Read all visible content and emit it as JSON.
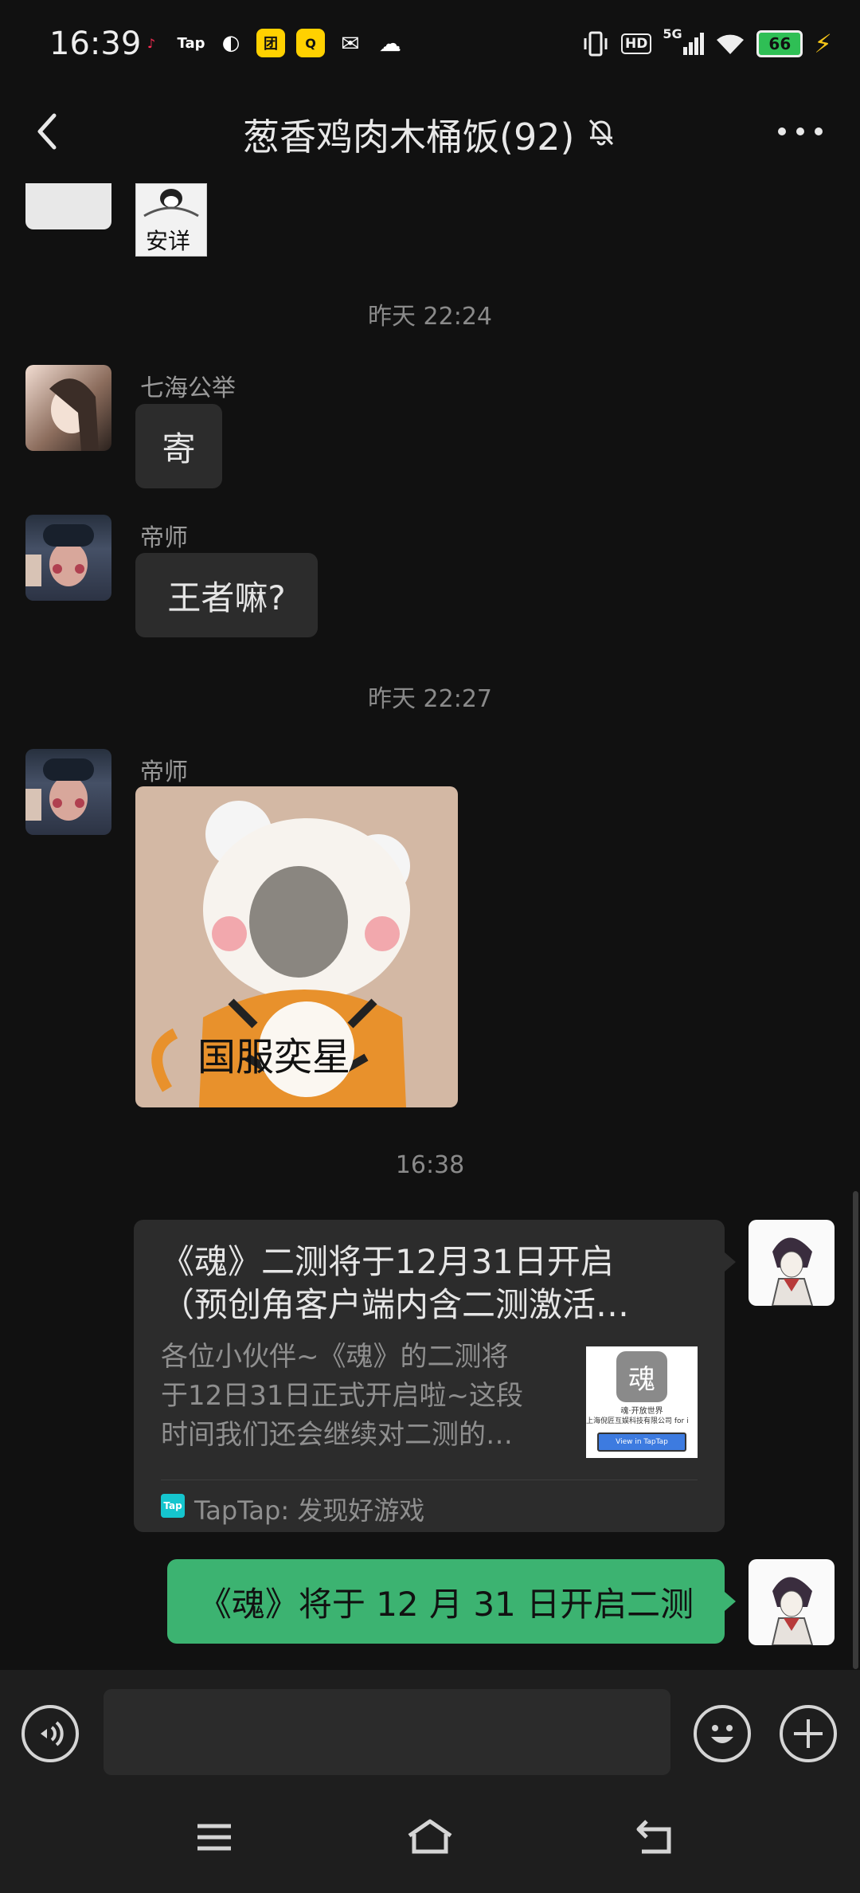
{
  "status_bar": {
    "time": "16:39",
    "apps": [
      {
        "name": "tiktok-icon",
        "label": "♪",
        "color": "#ff2d55"
      },
      {
        "name": "taptap-icon",
        "label": "Tap",
        "color": "#ffffff"
      },
      {
        "name": "speed-icon",
        "label": "◐",
        "color": "#ffffff"
      },
      {
        "name": "meituan-icon",
        "label": "团",
        "color": "#ffd100"
      },
      {
        "name": "qq-browser-icon",
        "label": "Q",
        "color": "#ffd100"
      },
      {
        "name": "mail-icon",
        "label": "✉",
        "color": "#ffffff"
      },
      {
        "name": "wechat-icon",
        "label": "☁",
        "color": "#ffffff"
      }
    ],
    "network": "5G",
    "hd": "HD",
    "battery": "66"
  },
  "header": {
    "title": "葱香鸡肉木桶饭(92)"
  },
  "messages": [
    {
      "sticker_label": "安详"
    },
    {
      "time": "昨天 22:24"
    },
    {
      "sender": "七海公举",
      "text": "寄"
    },
    {
      "sender": "帝师",
      "text": "王者嘛?"
    },
    {
      "time": "昨天 22:27"
    },
    {
      "sender": "帝师",
      "sticker_caption": "国服奕星"
    },
    {
      "time": "16:38"
    },
    {
      "link_card": {
        "title": "《魂》二测将于12月31日开启（预创角客户端内含二测激活…",
        "title_line1": "《魂》二测将于12月31日开启",
        "title_line2": "（预创角客户端内含二测激活…",
        "desc_line1": "各位小伙伴~《魂》的二测将",
        "desc_line2": "于12日31日正式开启啦~这段",
        "desc_line3": "时间我们还会继续对二测的…",
        "thumb_text1": "魂·开放世界",
        "thumb_text2": "上海倪匠互娱科技有限公司 for i",
        "thumb_button": "View in TapTap",
        "source_badge": "Tap",
        "source": "TapTap: 发现好游戏"
      }
    },
    {
      "text": "《魂》将于 12 月 31 日开启二测"
    }
  ],
  "colors": {
    "background": "#111111",
    "bubble_other": "#2c2c2c",
    "bubble_self": "#3cb371",
    "taptap": "#15c5ce"
  }
}
